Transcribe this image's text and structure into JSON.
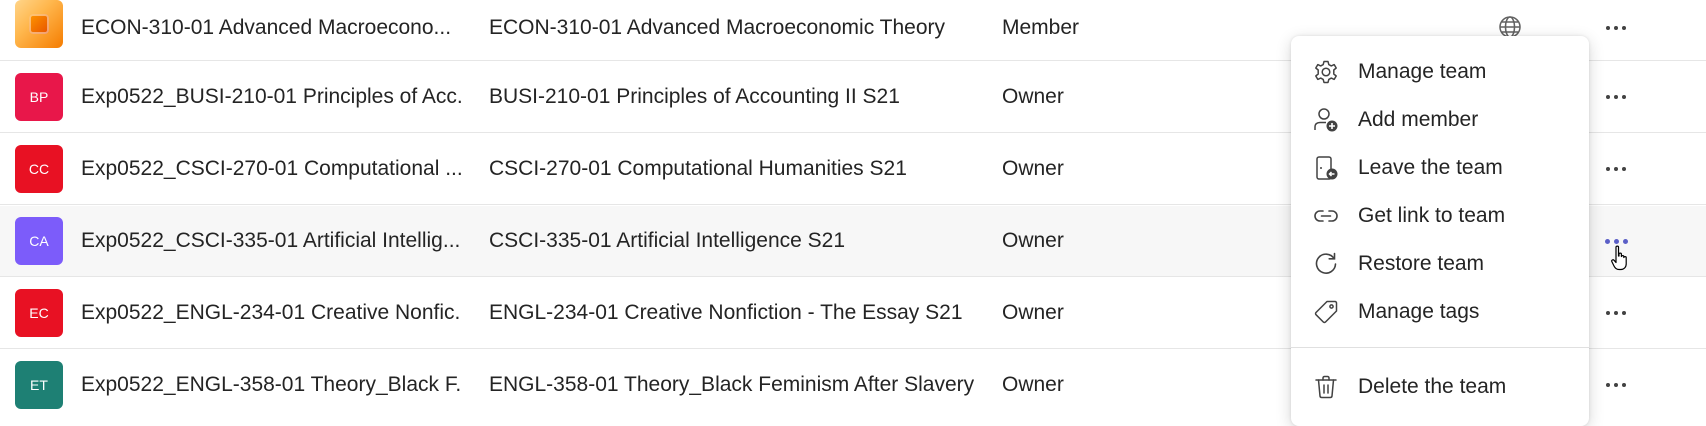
{
  "teams": [
    {
      "name": "ECON-310-01 Advanced Macroecono...",
      "description": "ECON-310-01 Advanced Macroeconomic Theory",
      "role": "Member",
      "avatar_initials": "",
      "avatar_color": "#f57c00",
      "shows_globe": true
    },
    {
      "name": "Exp0522_BUSI-210-01 Principles of Acc...",
      "description": "BUSI-210-01 Principles of Accounting II S21",
      "role": "Owner",
      "avatar_initials": "BP",
      "avatar_color": "#e8174a"
    },
    {
      "name": "Exp0522_CSCI-270-01 Computational ...",
      "description": "CSCI-270-01 Computational Humanities S21",
      "role": "Owner",
      "avatar_initials": "CC",
      "avatar_color": "#e81123"
    },
    {
      "name": "Exp0522_CSCI-335-01 Artificial Intellig...",
      "description": "CSCI-335-01 Artificial Intelligence S21",
      "role": "Owner",
      "avatar_initials": "CA",
      "avatar_color": "#7c5cfa"
    },
    {
      "name": "Exp0522_ENGL-234-01 Creative Nonfic...",
      "description": "ENGL-234-01 Creative Nonfiction - The Essay S21",
      "role": "Owner",
      "avatar_initials": "EC",
      "avatar_color": "#e81123"
    },
    {
      "name": "Exp0522_ENGL-358-01 Theory_Black F...",
      "description": "ENGL-358-01 Theory_Black Feminism After Slavery...",
      "role": "Owner",
      "avatar_initials": "ET",
      "avatar_color": "#1e8074"
    }
  ],
  "context_menu": {
    "items": [
      {
        "label": "Manage team",
        "icon": "gear-icon"
      },
      {
        "label": "Add member",
        "icon": "add-person-icon"
      },
      {
        "label": "Leave the team",
        "icon": "leave-icon"
      },
      {
        "label": "Get link to team",
        "icon": "link-icon"
      },
      {
        "label": "Restore team",
        "icon": "restore-icon"
      },
      {
        "label": "Manage tags",
        "icon": "tag-icon"
      }
    ],
    "delete_item": {
      "label": "Delete the team",
      "icon": "trash-icon"
    }
  },
  "colors": {
    "accent": "#5b5fc7"
  }
}
